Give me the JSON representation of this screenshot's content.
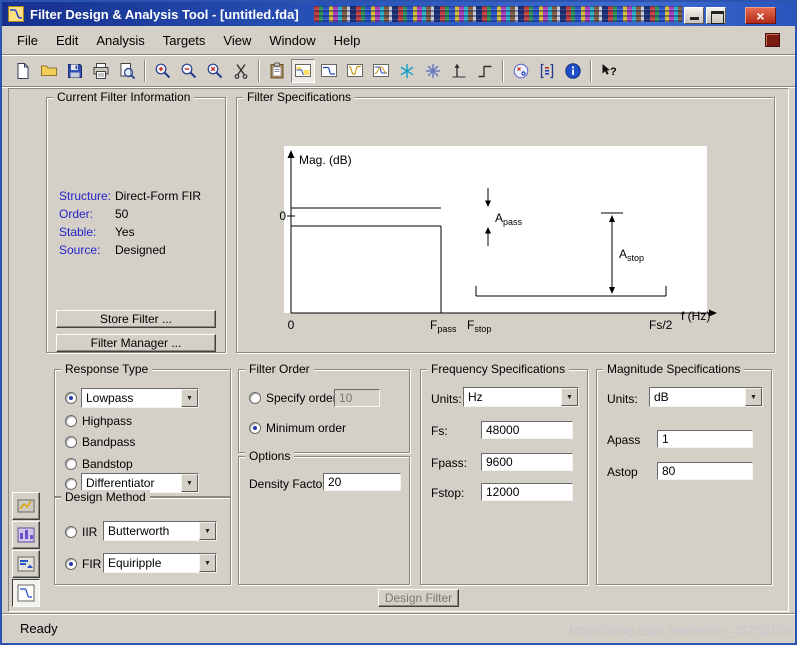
{
  "window": {
    "title": "Filter Design & Analysis Tool - [untitled.fda]",
    "controls": [
      "minimize-icon",
      "maximize-icon",
      "close-icon"
    ]
  },
  "menu": {
    "items": [
      "File",
      "Edit",
      "Analysis",
      "Targets",
      "View",
      "Window",
      "Help"
    ]
  },
  "toolbar": {
    "icons": [
      "new-icon",
      "open-icon",
      "save-icon",
      "print-icon",
      "print-preview-icon",
      "zoom-in-icon",
      "zoom-out-icon",
      "zoom-x-icon",
      "scissors-icon",
      "clipboard-icon",
      "filter-specifications-view-icon",
      "magnitude-response-icon",
      "phase-response-icon",
      "magnitude-phase-response-icon",
      "group-delay-icon",
      "phase-delay-icon",
      "impulse-response-icon",
      "step-response-icon",
      "pole-zero-plot-icon",
      "filter-coefficients-icon",
      "filter-information-icon",
      "context-help-icon"
    ]
  },
  "current_filter_info": {
    "title": "Current Filter Information",
    "fields": [
      {
        "label": "Structure:",
        "value": "Direct-Form FIR"
      },
      {
        "label": "Order:",
        "value": "50"
      },
      {
        "label": "Stable:",
        "value": "Yes"
      },
      {
        "label": "Source:",
        "value": "Designed"
      }
    ],
    "store_filter_button": "Store Filter ...",
    "filter_manager_button": "Filter Manager ..."
  },
  "filter_specifications": {
    "title": "Filter Specifications",
    "diagram": {
      "mag_label": "Mag. (dB)",
      "zero_level_label": "0",
      "origin_label": "0",
      "apass": {
        "main": "A",
        "sub": "pass"
      },
      "astop": {
        "main": "A",
        "sub": "stop"
      },
      "fpass": {
        "main": "F",
        "sub": "pass"
      },
      "fstop": {
        "main": "F",
        "sub": "stop"
      },
      "fs2_label": "Fs/2",
      "f_axis_label": "f (Hz)"
    }
  },
  "response_type": {
    "title": "Response Type",
    "lowpass_value": "Lowpass",
    "highpass_label": "Highpass",
    "bandpass_label": "Bandpass",
    "bandstop_label": "Bandstop",
    "differentiator_value": "Differentiator",
    "selected_option": "Lowpass"
  },
  "design_method": {
    "title": "Design Method",
    "iir_label": "IIR",
    "iir_value": "Butterworth",
    "fir_label": "FIR",
    "fir_value": "Equiripple",
    "selected_method": "FIR"
  },
  "filter_order": {
    "title": "Filter Order",
    "specify_order_label": "Specify order:",
    "specify_order_value": "10",
    "minimum_order_label": "Minimum order",
    "selected_option": "Minimum order"
  },
  "options": {
    "title": "Options",
    "density_factor_label": "Density Factor:",
    "density_factor_value": "20"
  },
  "frequency_specifications": {
    "title": "Frequency Specifications",
    "units_label": "Units:",
    "units_value": "Hz",
    "fs_label": "Fs:",
    "fs_value": "48000",
    "fpass_label": "Fpass:",
    "fpass_value": "9600",
    "fstop_label": "Fstop:",
    "fstop_value": "12000"
  },
  "magnitude_specifications": {
    "title": "Magnitude Specifications",
    "units_label": "Units:",
    "units_value": "dB",
    "apass_label": "Apass",
    "apass_value": "1",
    "astop_label": "Astop",
    "astop_value": "80"
  },
  "design_filter_button": {
    "label": "Design Filter",
    "enabled": false
  },
  "sidebar": {
    "icons": [
      "transform-filter-icon",
      "quantization-icon",
      "import-filter-icon",
      "design-filter-icon"
    ]
  },
  "statusbar": {
    "status": "Ready",
    "watermark": "https://blog.csdn.net/weixin_43760108"
  }
}
